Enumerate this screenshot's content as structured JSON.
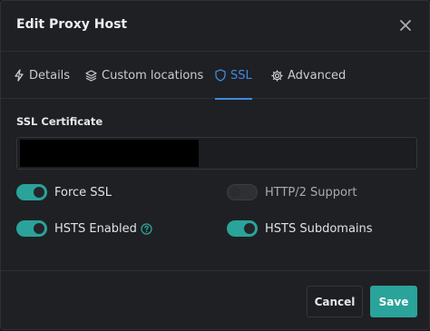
{
  "modal": {
    "title": "Edit Proxy Host",
    "close_symbol": "✕"
  },
  "tabs": [
    {
      "label": "Details",
      "icon": "lightning-icon"
    },
    {
      "label": "Custom locations",
      "icon": "layers-icon"
    },
    {
      "label": "SSL",
      "icon": "shield-icon",
      "active": true
    },
    {
      "label": "Advanced",
      "icon": "gear-icon"
    }
  ],
  "ssl": {
    "certificate_label": "SSL Certificate",
    "certificate_value": "",
    "toggles": [
      {
        "label": "Force SSL",
        "on": true
      },
      {
        "label": "HTTP/2 Support",
        "on": false
      },
      {
        "label": "HSTS Enabled",
        "on": true,
        "help_icon": "question-circle-icon"
      },
      {
        "label": "HSTS Subdomains",
        "on": true
      }
    ]
  },
  "footer": {
    "cancel_label": "Cancel",
    "save_label": "Save"
  },
  "colors": {
    "accent_teal": "#2aa39a",
    "active_tab_blue": "#3f8ae0",
    "background": "#1f2023"
  }
}
